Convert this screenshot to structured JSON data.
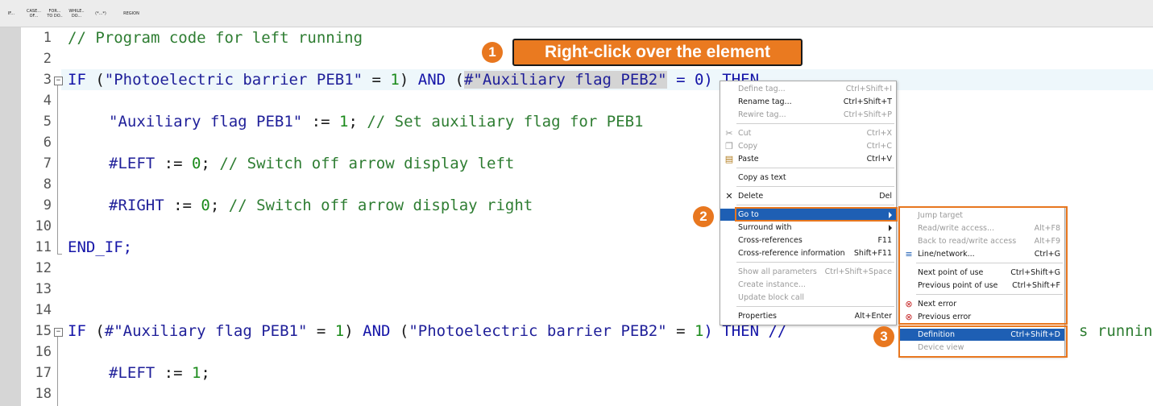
{
  "toolbar": {
    "buttons": [
      {
        "name": "tb-if-button",
        "label": "IF..."
      },
      {
        "name": "tb-case-button",
        "label": "CASE...\nOF..."
      },
      {
        "name": "tb-for-button",
        "label": "FOR...\nTO DO.."
      },
      {
        "name": "tb-while-button",
        "label": "WHILE..\nDO..."
      },
      {
        "name": "tb-comment-button",
        "label": "(*...*)"
      },
      {
        "name": "tb-region-button",
        "label": "REGION"
      }
    ]
  },
  "line_numbers": [
    "1",
    "2",
    "3",
    "4",
    "5",
    "6",
    "7",
    "8",
    "9",
    "10",
    "11",
    "12",
    "13",
    "14",
    "15",
    "16",
    "17",
    "18"
  ],
  "code": {
    "l1_comment": "// Program code for left running",
    "l3_if": "IF",
    "l3_open": " (",
    "l3_str1": "\"Photoelectric barrier PEB1\"",
    "l3_eq1": " = ",
    "l3_one": "1",
    "l3_close1": ")",
    "l3_and": " AND ",
    "l3_paren": "(",
    "l3_sel": "#\"Auxiliary flag PEB2\"",
    "l3_rest": " = 0) THEN",
    "l5_str": "\"Auxiliary flag PEB1\"",
    "l5_assign": " := ",
    "l5_val": "1",
    "l5_semi": "; ",
    "l5_cmt": "// Set auxiliary flag for PEB1",
    "l7_var": "#LEFT",
    "l7_assign": " := ",
    "l7_val": "0",
    "l7_semi": "; ",
    "l7_cmt": "// Switch off arrow display left",
    "l9_var": "#RIGHT",
    "l9_assign": " := ",
    "l9_val": "0",
    "l9_semi": "; ",
    "l9_cmt": "// Switch off arrow display right",
    "l11": "END_IF;",
    "l15_if": "IF",
    "l15_open": " (",
    "l15_str1": "#\"Auxiliary flag PEB1\"",
    "l15_eq1": " = ",
    "l15_one": "1",
    "l15_close1": ")",
    "l15_and": " AND ",
    "l15_open2": "(",
    "l15_str2": "\"Photoelectric barrier PEB2\"",
    "l15_eq2": " = ",
    "l15_one2": "1",
    "l15_then": ") THEN // ",
    "l15_tail": "s running",
    "l17_var": "#LEFT",
    "l17_assign": " := ",
    "l17_val": "1",
    "l17_semi": ";"
  },
  "callouts": {
    "step1_num": "1",
    "step1_text": "Right-click over the element",
    "step2_num": "2",
    "step3_num": "3"
  },
  "context_menu": {
    "items": [
      {
        "label": "Define tag...",
        "shortcut": "Ctrl+Shift+I",
        "disabled": true
      },
      {
        "label": "Rename tag...",
        "shortcut": "Ctrl+Shift+T",
        "disabled": false
      },
      {
        "label": "Rewire tag...",
        "shortcut": "Ctrl+Shift+P",
        "disabled": true
      },
      {
        "label": "Cut",
        "shortcut": "Ctrl+X",
        "disabled": true,
        "icon": "scissors-icon"
      },
      {
        "label": "Copy",
        "shortcut": "Ctrl+C",
        "disabled": true,
        "icon": "copy-icon"
      },
      {
        "label": "Paste",
        "shortcut": "Ctrl+V",
        "disabled": false,
        "icon": "paste-icon"
      },
      {
        "label": "Copy as text",
        "shortcut": "",
        "disabled": false
      },
      {
        "label": "Delete",
        "shortcut": "Del",
        "disabled": false,
        "icon": "delete-icon"
      },
      {
        "label": "Go to",
        "shortcut": "",
        "disabled": false,
        "submenu": true,
        "active": true
      },
      {
        "label": "Surround with",
        "shortcut": "",
        "disabled": false,
        "submenu": true
      },
      {
        "label": "Cross-references",
        "shortcut": "F11",
        "disabled": false
      },
      {
        "label": "Cross-reference information",
        "shortcut": "Shift+F11",
        "disabled": false
      },
      {
        "label": "Show all parameters",
        "shortcut": "Ctrl+Shift+Space",
        "disabled": true
      },
      {
        "label": "Create instance...",
        "shortcut": "",
        "disabled": true
      },
      {
        "label": "Update block call",
        "shortcut": "",
        "disabled": true
      },
      {
        "label": "Properties",
        "shortcut": "Alt+Enter",
        "disabled": false
      }
    ]
  },
  "submenu": {
    "items": [
      {
        "label": "Jump target",
        "shortcut": "",
        "disabled": true
      },
      {
        "label": "Read/write access...",
        "shortcut": "Alt+F8",
        "disabled": true
      },
      {
        "label": "Back to read/write access",
        "shortcut": "Alt+F9",
        "disabled": true
      },
      {
        "label": "Line/network...",
        "shortcut": "Ctrl+G",
        "disabled": false,
        "icon": "line-network-icon"
      },
      {
        "label": "Next point of use",
        "shortcut": "Ctrl+Shift+G",
        "disabled": false
      },
      {
        "label": "Previous point of use",
        "shortcut": "Ctrl+Shift+F",
        "disabled": false
      },
      {
        "label": "Next error",
        "shortcut": "",
        "disabled": false,
        "icon": "next-error-icon"
      },
      {
        "label": "Previous error",
        "shortcut": "",
        "disabled": false,
        "icon": "previous-error-icon"
      },
      {
        "label": "Definition",
        "shortcut": "Ctrl+Shift+D",
        "disabled": false,
        "active": true
      },
      {
        "label": "Device view",
        "shortcut": "",
        "disabled": true
      }
    ]
  },
  "colors": {
    "accent_orange": "#e8771f",
    "menu_highlight": "#1e5fb4",
    "keyword": "#1515a8",
    "number": "#1a8a1a",
    "comment": "#2e7d32"
  }
}
